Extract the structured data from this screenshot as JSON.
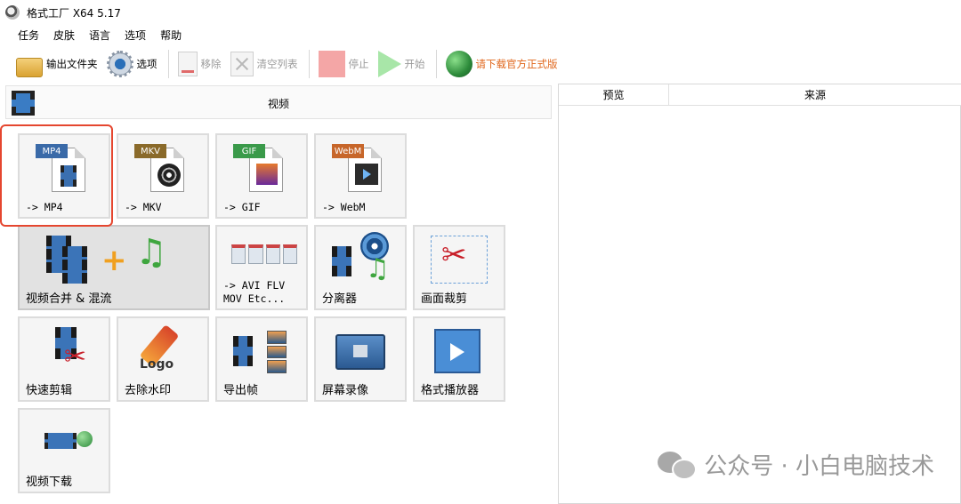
{
  "window": {
    "title": "格式工厂 X64 5.17"
  },
  "menu": [
    "任务",
    "皮肤",
    "语言",
    "选项",
    "帮助"
  ],
  "toolbar": {
    "output_folder": "输出文件夹",
    "options": "选项",
    "remove": "移除",
    "clear_list": "清空列表",
    "stop": "停止",
    "start": "开始",
    "download_official": "请下载官方正式版"
  },
  "category": {
    "label": "视频"
  },
  "tiles": {
    "mp4": {
      "badge": "MP4",
      "label": "-> MP4",
      "badge_color": "#3a6aa8"
    },
    "mkv": {
      "badge": "MKV",
      "label": "-> MKV",
      "badge_color": "#8a6a2a"
    },
    "gif": {
      "badge": "GIF",
      "label": "-> GIF",
      "badge_color": "#3a9a4a"
    },
    "webm": {
      "badge": "WebM",
      "label": "-> WebM",
      "badge_color": "#c7662a"
    },
    "merge": {
      "label": "视频合并 & 混流"
    },
    "avi": {
      "label": "-> AVI FLV\nMOV Etc..."
    },
    "splitter": {
      "label": "分离器"
    },
    "crop": {
      "label": "画面裁剪"
    },
    "quick_edit": {
      "label": "快速剪辑"
    },
    "remove_watermark": {
      "label": "去除水印",
      "logo_text": "Logo"
    },
    "export_frames": {
      "label": "导出帧"
    },
    "screen_record": {
      "label": "屏幕录像"
    },
    "player": {
      "label": "格式播放器"
    },
    "video_download": {
      "label": "视频下载"
    }
  },
  "task_list": {
    "columns": [
      "预览",
      "来源"
    ]
  },
  "watermark": {
    "text": "公众号 · 小白电脑技术"
  },
  "colors": {
    "highlight": "#e5462f",
    "download_text": "#e0661b"
  }
}
